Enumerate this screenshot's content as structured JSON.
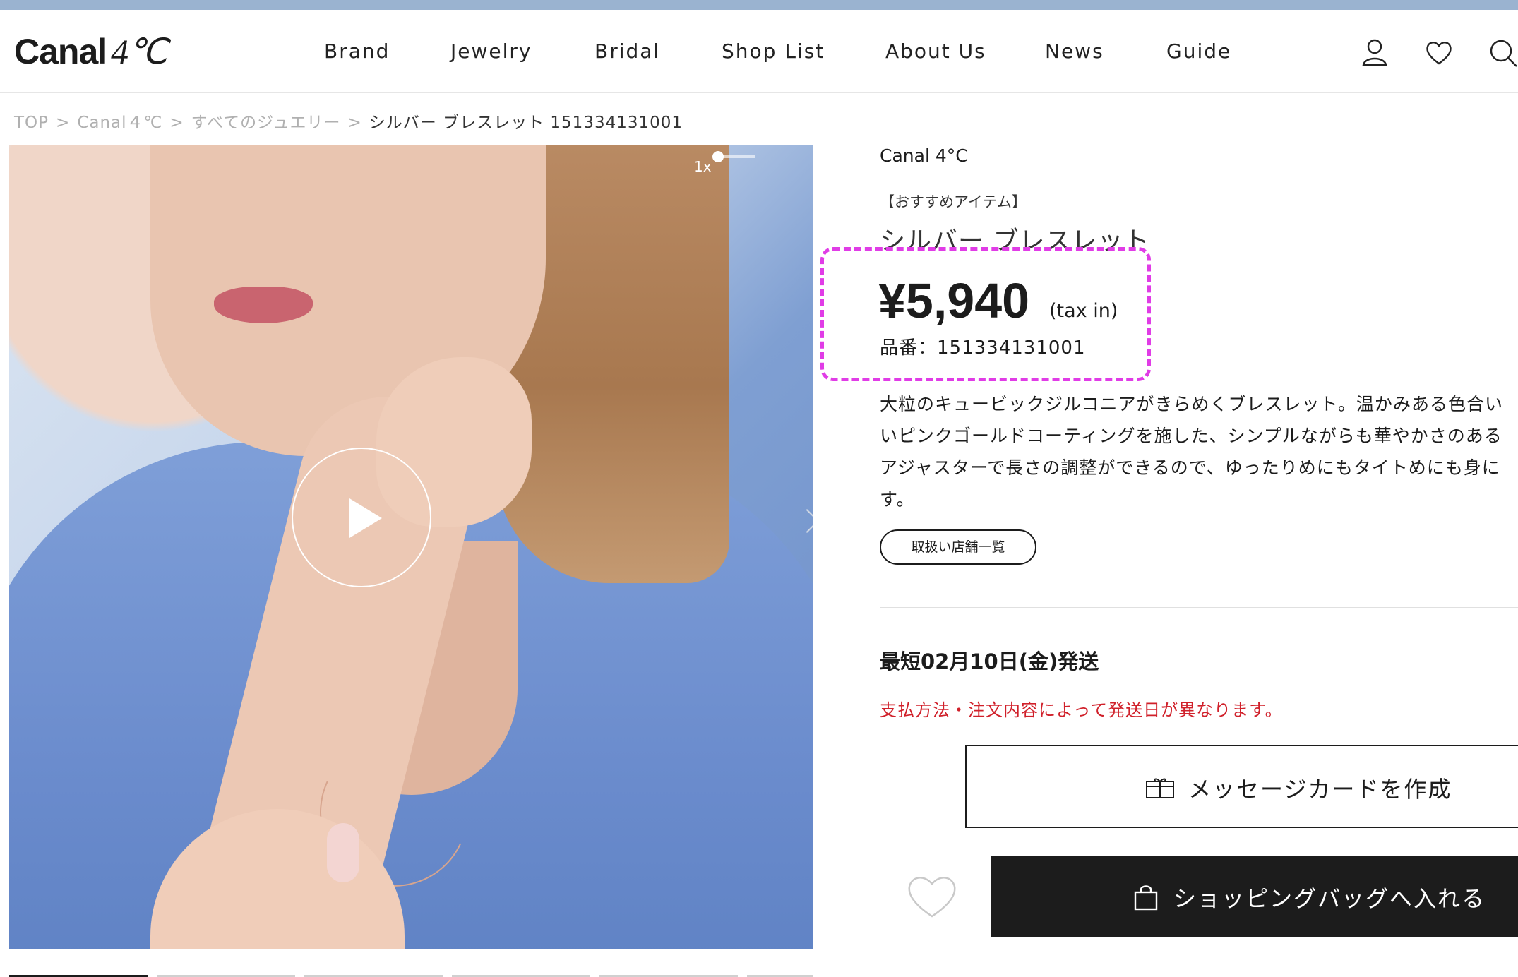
{
  "header": {
    "logo_text": "Canal",
    "logo_mark": "4℃",
    "nav": [
      "Brand",
      "Jewelry",
      "Bridal",
      "Shop List",
      "About Us",
      "News",
      "Guide"
    ],
    "icons": [
      "user-icon",
      "heart-icon",
      "search-icon"
    ]
  },
  "breadcrumb": {
    "items": [
      "TOP",
      "Canal４℃",
      "すべてのジュエリー"
    ],
    "separator": ">",
    "current": "シルバー ブレスレット 151334131001"
  },
  "media": {
    "speed": "1x",
    "play_icon": "play-icon",
    "next_icon": "chevron-right-icon"
  },
  "product": {
    "brand": "Canal 4°C",
    "tag": "【おすすめアイテム】",
    "title": "シルバー ブレスレット",
    "price": "¥5,940",
    "tax": "(tax in)",
    "sku": "品番：151334131001",
    "description": [
      "大粒のキュービックジルコニアがきらめくブレスレット。温かみある色合い",
      "いピンクゴールドコーティングを施した、シンプルながらも華やかさのある",
      "アジャスターで長さの調整ができるので、ゆったりめにもタイトめにも身に",
      "す。"
    ],
    "stores_button": "取扱い店舗一覧",
    "ship_date": "最短02月10日(金)発送",
    "ship_note": "支払方法・注文内容によって発送日が異なります。",
    "message_card_button": "メッセージカードを作成",
    "bag_button": "ショッピングバッグへ入れる"
  },
  "colors": {
    "top_stripe": "#9ab3d0",
    "highlight": "#e03ce6",
    "notice_red": "#d0202a",
    "button_dark": "#1c1c1c"
  }
}
